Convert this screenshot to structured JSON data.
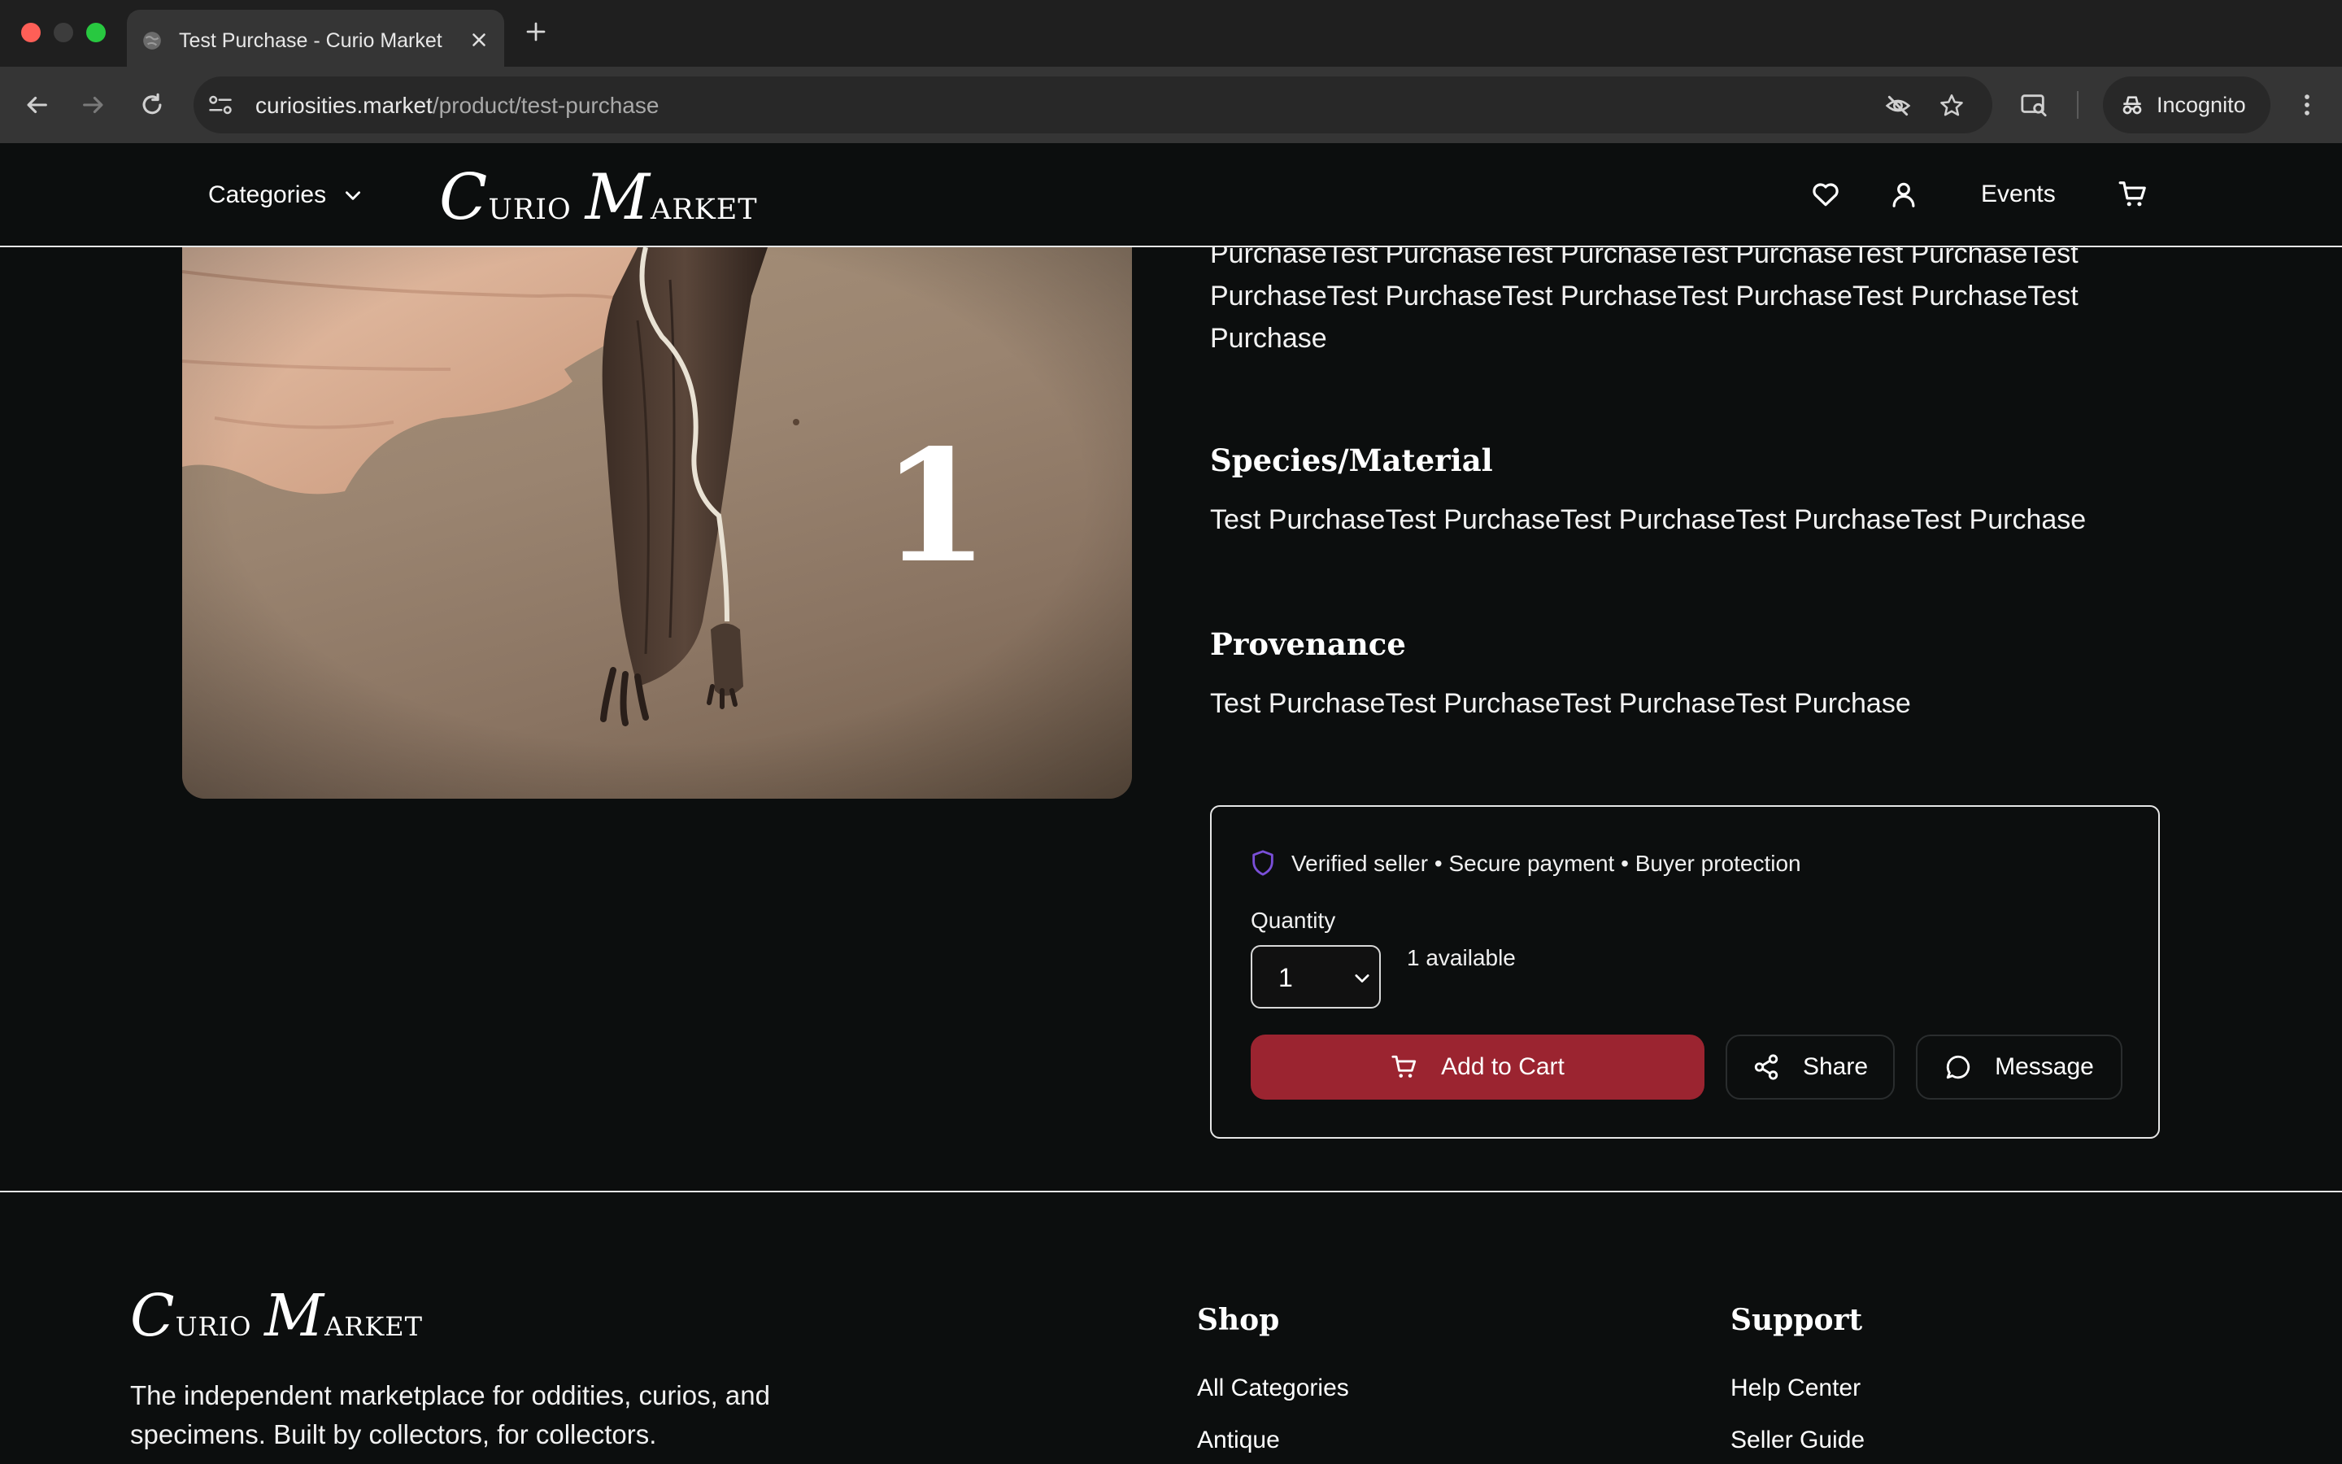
{
  "browser": {
    "tab_title": "Test Purchase - Curio Market",
    "url_host": "curiosities.market",
    "url_path": "/product/test-purchase",
    "incognito_label": "Incognito"
  },
  "header": {
    "categories_label": "Categories",
    "logo_first_initial": "C",
    "logo_first_rest": "urio",
    "logo_second_initial": "M",
    "logo_second_rest": "arket",
    "events_label": "Events"
  },
  "product": {
    "image_number_overlay": "1",
    "description_lines": [
      "PurchaseTest PurchaseTest PurchaseTest PurchaseTest PurchaseTest",
      "PurchaseTest PurchaseTest PurchaseTest PurchaseTest PurchaseTest",
      "Purchase"
    ],
    "species_title": "Species/Material",
    "species_text": "Test PurchaseTest PurchaseTest PurchaseTest PurchaseTest Purchase",
    "provenance_title": "Provenance",
    "provenance_text": "Test PurchaseTest PurchaseTest PurchaseTest Purchase"
  },
  "purchase": {
    "trust_text": "Verified seller • Secure payment • Buyer protection",
    "quantity_label": "Quantity",
    "quantity_value": "1",
    "available_text": "1 available",
    "add_to_cart_label": "Add to Cart",
    "share_label": "Share",
    "message_label": "Message"
  },
  "footer": {
    "logo_first_initial": "C",
    "logo_first_rest": "urio",
    "logo_second_initial": "M",
    "logo_second_rest": "arket",
    "tagline_line1": "The independent marketplace for oddities, curios, and",
    "tagline_line2": "specimens. Built by collectors, for collectors.",
    "shop_heading": "Shop",
    "shop_links": [
      "All Categories",
      "Antique"
    ],
    "support_heading": "Support",
    "support_links": [
      "Help Center",
      "Seller Guide"
    ]
  },
  "colors": {
    "background": "#0c0e0e",
    "accent_button": "#9b2430",
    "shield_icon": "#7a4fd8"
  }
}
